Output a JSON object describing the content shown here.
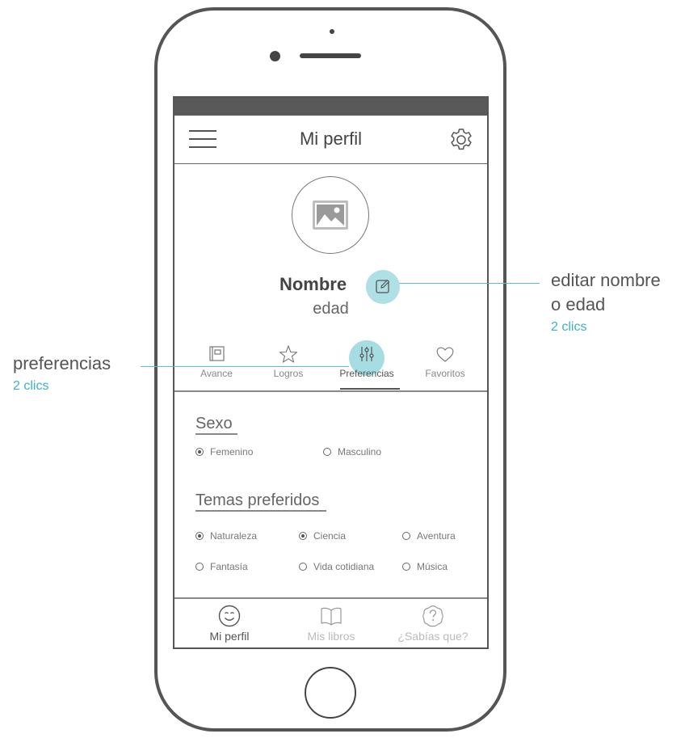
{
  "header": {
    "title": "Mi perfil"
  },
  "profile": {
    "name": "Nombre",
    "age": "edad"
  },
  "tabs": [
    {
      "label": "Avance",
      "icon": "notebook-icon"
    },
    {
      "label": "Logros",
      "icon": "star-icon"
    },
    {
      "label": "Preferencias",
      "icon": "sliders-icon",
      "active": true
    },
    {
      "label": "Favoritos",
      "icon": "heart-icon"
    }
  ],
  "sexo": {
    "title": "Sexo",
    "options": [
      {
        "label": "Femenino",
        "selected": true
      },
      {
        "label": "Masculino",
        "selected": false
      }
    ]
  },
  "temas": {
    "title": "Temas preferidos",
    "options": [
      {
        "label": "Naturaleza",
        "selected": true
      },
      {
        "label": "Ciencia",
        "selected": true
      },
      {
        "label": "Aventura",
        "selected": false
      },
      {
        "label": "Fantasía",
        "selected": false
      },
      {
        "label": "Vida cotidiana",
        "selected": false
      },
      {
        "label": "Música",
        "selected": false
      }
    ]
  },
  "bottom_nav": [
    {
      "label": "Mi perfil",
      "icon": "smiley-icon",
      "active": true
    },
    {
      "label": "Mis libros",
      "icon": "book-icon",
      "active": false
    },
    {
      "label": "¿Sabías que?",
      "icon": "question-icon",
      "active": false
    }
  ],
  "annotations": {
    "edit": {
      "line1": "editar nombre",
      "line2": "o edad",
      "clicks": "2 clics"
    },
    "prefs": {
      "label": "preferencias",
      "clicks": "2 clics"
    }
  },
  "colors": {
    "highlight": "#a6dde2",
    "accent": "#3bb3c3",
    "status_bar": "#595959"
  }
}
